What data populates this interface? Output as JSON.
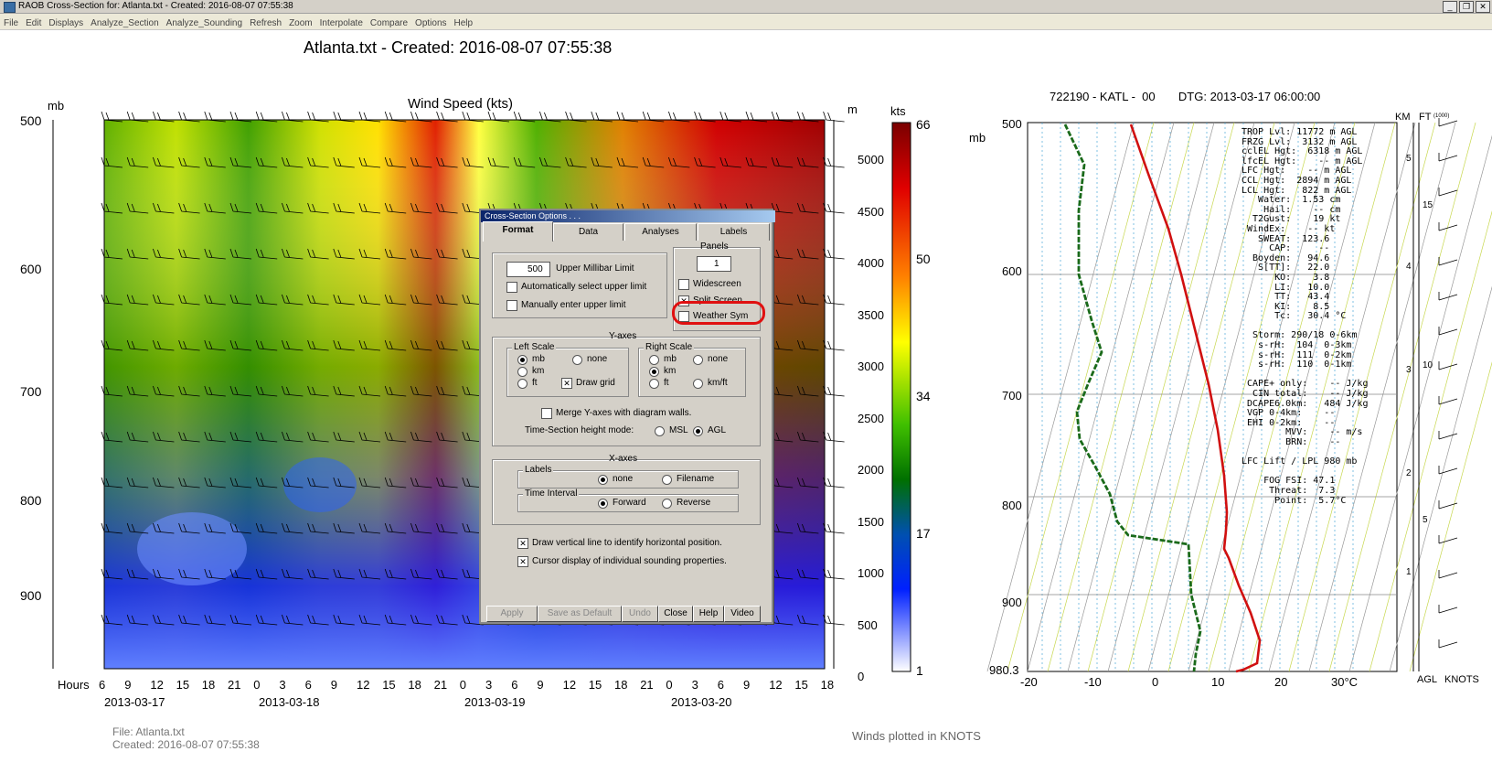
{
  "window": {
    "title": "RAOB Cross-Section for: Atlanta.txt - Created:  2016-08-07  07:55:38",
    "buttons": [
      "_",
      "❐",
      "✕"
    ]
  },
  "menu": [
    "File",
    "Edit",
    "Displays",
    "Analyze_Section",
    "Analyze_Sounding",
    "Refresh",
    "Zoom",
    "Interpolate",
    "Compare",
    "Options",
    "Help"
  ],
  "header": {
    "title": "Atlanta.txt - Created:  2016-08-07  07:55:38"
  },
  "cross_section": {
    "title": "Wind Speed (kts)",
    "left_unit": "mb",
    "right_unit": "m",
    "colorbar_unit": "kts",
    "left_ticks": [
      "500",
      "600",
      "700",
      "800",
      "900"
    ],
    "right_ticks": [
      "5000",
      "4500",
      "4000",
      "3500",
      "3000",
      "2500",
      "2000",
      "1500",
      "1000",
      "500",
      "0"
    ],
    "colorbar_ticks": [
      "66",
      "50",
      "34",
      "17",
      "1"
    ],
    "hours_label": "Hours",
    "hours": [
      "6",
      "9",
      "12",
      "15",
      "18",
      "21",
      "0",
      "3",
      "6",
      "9",
      "12",
      "15",
      "18",
      "21",
      "0",
      "3",
      "6",
      "9",
      "12",
      "15",
      "18",
      "21",
      "0",
      "3",
      "6",
      "9",
      "12",
      "15",
      "18"
    ],
    "dates": [
      "2013-03-17",
      "2013-03-18",
      "2013-03-19",
      "2013-03-20"
    ],
    "footer_file": "File: Atlanta.txt",
    "footer_created": "Created:  2016-08-07  07:55:38",
    "winds_note": "Winds plotted in KNOTS"
  },
  "dialog": {
    "title": "Cross-Section Options . . .",
    "tabs": [
      "Format",
      "Data",
      "Analyses",
      "Labels"
    ],
    "upper_mb_value": "500",
    "upper_mb_label": "Upper Millibar Limit",
    "auto_upper": "Automatically select upper limit",
    "manual_upper": "Manually enter upper limit",
    "panels_label": "Panels",
    "panels_value": "1",
    "widescreen": "Widescreen",
    "split_screen": "Split Screen",
    "weather_sym": "Weather Sym",
    "yaxes": "Y-axes",
    "left_scale": "Left Scale",
    "right_scale": "Right Scale",
    "mb": "mb",
    "km": "km",
    "ft": "ft",
    "none": "none",
    "draw_grid": "Draw grid",
    "kmft": "km/ft",
    "merge": "Merge Y-axes with diagram walls.",
    "height_mode": "Time-Section height mode:",
    "msl": "MSL",
    "agl": "AGL",
    "xaxes": "X-axes",
    "labels": "Labels",
    "filename": "Filename",
    "time_interval": "Time Interval",
    "forward": "Forward",
    "reverse": "Reverse",
    "vert_line": "Draw vertical line to identify horizontal position.",
    "cursor_disp": "Cursor display of individual sounding properties.",
    "buttons": [
      "Apply",
      "Save as Default",
      "Undo",
      "Close",
      "Help",
      "Video"
    ]
  },
  "sounding": {
    "header": "722190 - KATL -  00       DTG: 2013-03-17 06:00:00",
    "mb_label": "mb",
    "mb_ticks": [
      "500",
      "600",
      "700",
      "800",
      "900",
      "980.3"
    ],
    "temp_ticks": [
      "-20",
      "-10",
      "0",
      "10",
      "20",
      "30°C"
    ],
    "km_label": "KM",
    "ft_label": "FT",
    "ft_sub": "(1000)",
    "km_ticks": [
      "5",
      "4",
      "3",
      "2",
      "1"
    ],
    "ft_ticks": [
      "15",
      "10",
      "5"
    ],
    "agl": "AGL",
    "knots": "KNOTS",
    "stats": "TROP Lvl: 11772 m AGL\nFRZG Lvl:  3132 m AGL\ncclEL Hgt:  6318 m AGL\nlfcEL Hgt:    -- m AGL\nLFC Hgt:    -- m AGL\nCCL Hgt:  2894 m AGL\nLCL Hgt:   822 m AGL\n   Water:  1.53 cm\n    Hail:    -- cm\n  T2Gust:    19 kt\n WindEx:    -- kt\n   SWEAT:  123.6\n     CAP:     --\n  Boyden:   94.6\n   S[TT]:   22.0\n      KO:    3.8\n      LI:   10.0\n      TT:   43.4\n      KI:    8.5\n      Tc:   30.4 °C\n\n  Storm: 290/18 0-6km\n   s-rH:  104  0-3km\n   s-rH:  111  0-2km\n   s-rH:  110  0-1km\n\n CAPE+ only:    -- J/kg\n  CIN total:    -- J/kg\n DCAPE6.0km:   484 J/kg\n VGP 0-4km:    --\n EHI 0-2km:    --\n        MVV:    -- m/s\n        BRN:    --\n\nLFC Lift / LPL 980 mb\n\n    FOG FSI: 47.1\n     Threat:  7.3\n      Point:  5.7°C",
    "colors": {
      "temp": "#d01010",
      "dew": "#1a6a1a"
    }
  }
}
